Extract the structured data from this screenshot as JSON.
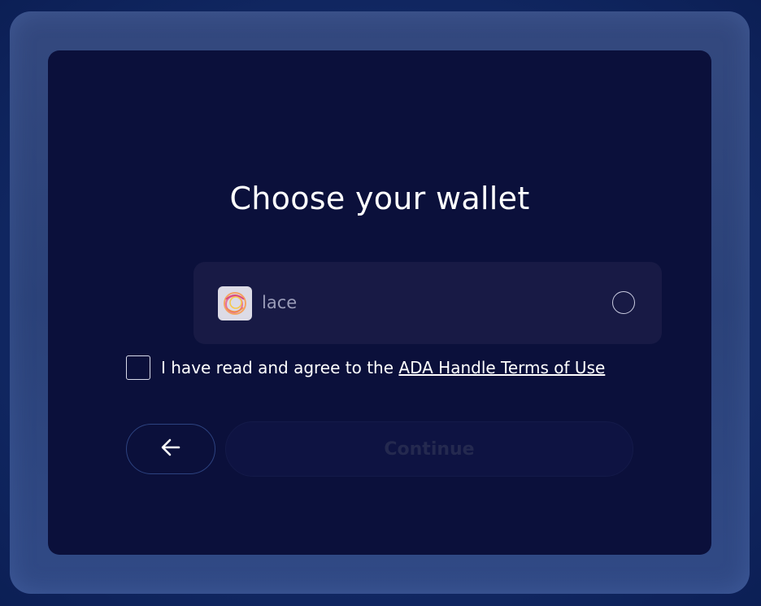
{
  "dialog": {
    "title": "Choose your wallet"
  },
  "wallets": [
    {
      "name": "lace",
      "icon": "lace-logo-icon",
      "selected": false
    }
  ],
  "terms": {
    "checked": false,
    "prefix": "I have read and agree to the ",
    "link_label": "ADA Handle Terms of Use"
  },
  "actions": {
    "back_icon": "arrow-left-icon",
    "continue_label": "Continue",
    "continue_enabled": false
  },
  "colors": {
    "background": "#122a66",
    "frame": "#2f4680",
    "dialog": "#0b103b",
    "card": "#181a45",
    "text": "#ffffff",
    "muted_text": "#9a9cb8",
    "disabled_text": "#24294f"
  }
}
